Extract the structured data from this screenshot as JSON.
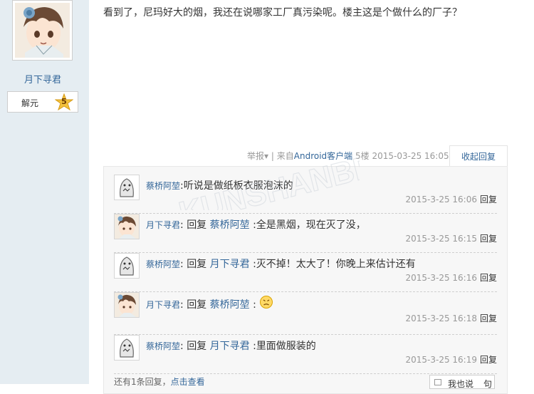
{
  "author": {
    "name": "月下寻君",
    "rank_title": "解元",
    "rank_level": "5"
  },
  "post": {
    "content": "看到了，尼玛好大的烟，我还在说哪家工厂真污染呢。楼主这是个做什么的厂子？",
    "report_label": "举报",
    "report_arrow": "▾",
    "separator": "|",
    "client_prefix": "来自",
    "client_name": "Android客户端",
    "floor": "5楼",
    "time": "2015-03-25 16:05",
    "collapse_label": "收起回复"
  },
  "watermark_text": "KUNSHANBBS",
  "comments": [
    {
      "author": "蔡桥阿堃",
      "reply_prefix": "",
      "target": "",
      "separator": ":",
      "text": "听说是做纸板衣服泡沫的",
      "time": "2015-3-25 16:06",
      "reply_label": "回复",
      "avatar": "gray-creature"
    },
    {
      "author": "月下寻君",
      "reply_prefix": "回复",
      "target": "蔡桥阿堃",
      "separator": ":",
      "text": "全是黑烟，现在灭了没，",
      "time": "2015-3-25 16:15",
      "reply_label": "回复",
      "avatar": "anime-boy"
    },
    {
      "author": "蔡桥阿堃",
      "reply_prefix": "回复",
      "target": "月下寻君",
      "separator": ":",
      "text": "灭不掉！太大了！你晚上来估计还有",
      "time": "2015-3-25 16:16",
      "reply_label": "回复",
      "avatar": "gray-creature"
    },
    {
      "author": "月下寻君",
      "reply_prefix": "回复",
      "target": "蔡桥阿堃",
      "separator": ":",
      "text": "",
      "emoji": "😣",
      "time": "2015-3-25 16:18",
      "reply_label": "回复",
      "avatar": "anime-boy"
    },
    {
      "author": "蔡桥阿堃",
      "reply_prefix": "回复",
      "target": "月下寻君",
      "separator": ":",
      "text": "里面做服装的",
      "time": "2015-3-25 16:19",
      "reply_label": "回复",
      "avatar": "gray-creature"
    }
  ],
  "more_replies": {
    "text": "还有1条回复，",
    "link": "点击查看"
  },
  "say_button": {
    "label": "我也说",
    "suffix": "句"
  },
  "colors": {
    "link": "#336699",
    "sidebar_bg": "#e5edf2",
    "comment_bg": "#f7f7f7",
    "meta": "#999999"
  }
}
